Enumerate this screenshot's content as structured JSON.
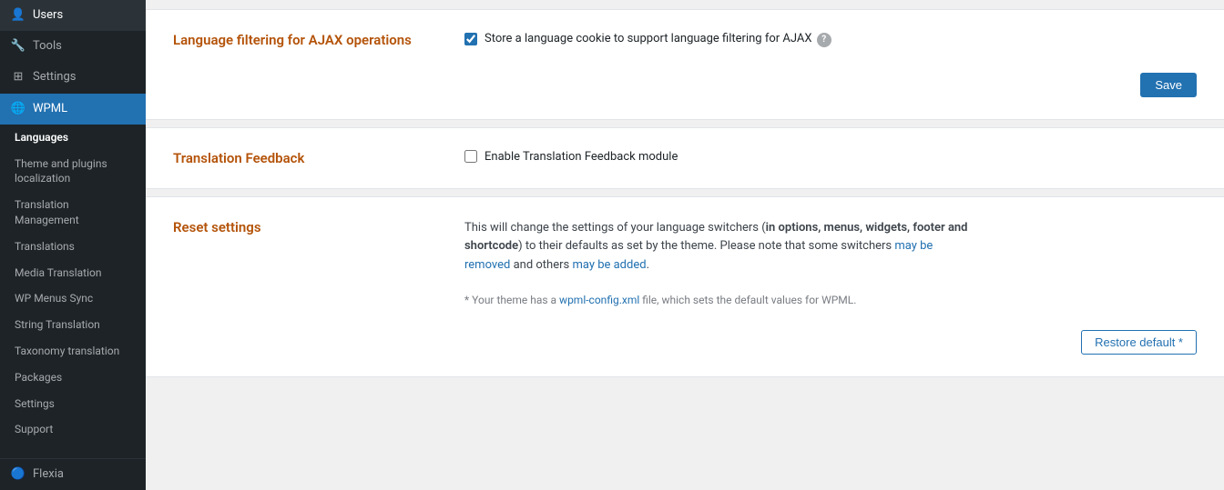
{
  "sidebar": {
    "items": [
      {
        "id": "users",
        "label": "Users",
        "icon": "👤",
        "active": false
      },
      {
        "id": "tools",
        "label": "Tools",
        "icon": "🔧",
        "active": false
      },
      {
        "id": "settings",
        "label": "Settings",
        "icon": "⊞",
        "active": false
      },
      {
        "id": "wpml",
        "label": "WPML",
        "icon": "🌐",
        "active": true
      }
    ],
    "submenu": [
      {
        "id": "languages",
        "label": "Languages",
        "active": true
      },
      {
        "id": "theme-plugins",
        "label": "Theme and plugins localization",
        "active": false
      },
      {
        "id": "translation-management",
        "label": "Translation Management",
        "active": false
      },
      {
        "id": "translations",
        "label": "Translations",
        "active": false
      },
      {
        "id": "media-translation",
        "label": "Media Translation",
        "active": false
      },
      {
        "id": "wp-menus-sync",
        "label": "WP Menus Sync",
        "active": false
      },
      {
        "id": "string-translation",
        "label": "String Translation",
        "active": false
      },
      {
        "id": "taxonomy-translation",
        "label": "Taxonomy translation",
        "active": false
      },
      {
        "id": "packages",
        "label": "Packages",
        "active": false
      },
      {
        "id": "settings-sub",
        "label": "Settings",
        "active": false
      },
      {
        "id": "support",
        "label": "Support",
        "active": false
      }
    ],
    "bottom": {
      "label": "Flexia",
      "icon": "🔵"
    }
  },
  "sections": {
    "ajax": {
      "title": "Language filtering for AJAX operations",
      "checkbox_label": "Store a language cookie to support language filtering for AJAX",
      "checked": true,
      "save_button": "Save",
      "help": "?"
    },
    "feedback": {
      "title": "Translation Feedback",
      "checkbox_label": "Enable Translation Feedback module",
      "checked": false
    },
    "reset": {
      "title": "Reset settings",
      "description_parts": {
        "before": "This will change the settings of your language switchers (",
        "bold1": "in options, menus, widgets, footer and shortcode",
        "middle": ") to their defaults as set by the theme. Please note that some switchers ",
        "link1": "may be removed",
        "after1": " and others ",
        "link2": "may be added",
        "after2": "."
      },
      "note_before": "* Your theme has a ",
      "note_link": "wpml-config.xml",
      "note_after": " file, which sets the default values for WPML.",
      "restore_button": "Restore default *"
    }
  }
}
